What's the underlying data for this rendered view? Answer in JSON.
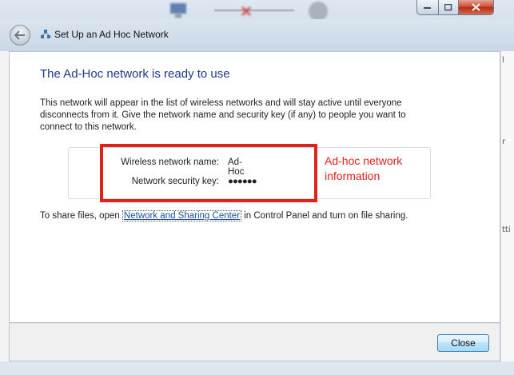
{
  "wizard": {
    "title": "Set Up an Ad Hoc Network",
    "heading": "The Ad-Hoc network is ready to use",
    "description": "This network will appear in the list of wireless networks and will stay active until everyone disconnects from it. Give the network name and security key (if any) to people you want to connect to this network.",
    "network_name_label": "Wireless network name:",
    "network_name_value": "Ad-Hoc",
    "security_key_label": "Network security key:",
    "security_key_value": "●●●●●●",
    "share_prefix": "To share files, open ",
    "share_link": "Network and Sharing Center",
    "share_suffix": " in Control Panel and turn on file sharing.",
    "close_label": "Close"
  },
  "annotation": {
    "text": "Ad-hoc network information",
    "color": "#e0221b"
  },
  "icons": {
    "back": "back-arrow-icon",
    "wizard": "network-icon",
    "minimize": "minimize-icon",
    "maximize": "maximize-icon",
    "close": "close-icon"
  },
  "background": {
    "right_edge_letters": [
      "l",
      "r",
      "tti"
    ]
  }
}
